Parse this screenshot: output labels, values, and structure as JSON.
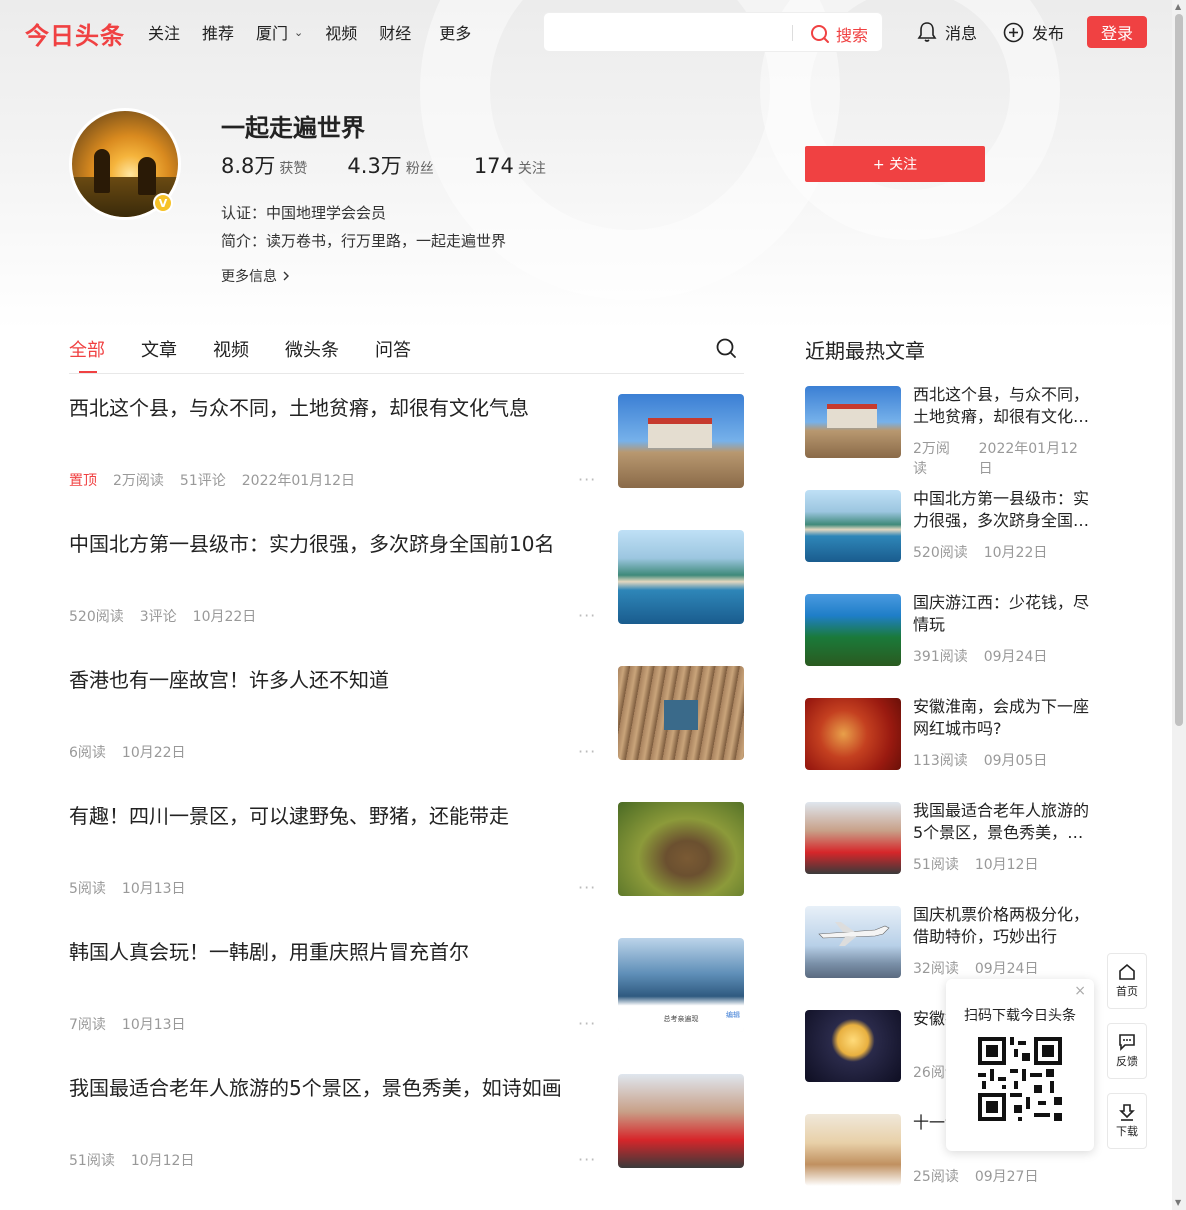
{
  "header": {
    "logo": "今日头条",
    "nav": [
      {
        "label": "关注"
      },
      {
        "label": "推荐"
      },
      {
        "label": "厦门",
        "dropdown": true
      },
      {
        "label": "视频"
      },
      {
        "label": "财经"
      },
      {
        "label": "更多"
      }
    ],
    "search": {
      "placeholder": "",
      "button": "搜索"
    },
    "messages": "消息",
    "publish": "发布",
    "login": "登录"
  },
  "profile": {
    "name": "一起走遍世界",
    "stats": [
      {
        "num": "8.8万",
        "label": "获赞"
      },
      {
        "num": "4.3万",
        "label": "粉丝"
      },
      {
        "num": "174",
        "label": "关注"
      }
    ],
    "certification": "认证：中国地理学会会员",
    "bio": "简介：读万卷书，行万里路，一起走遍世界",
    "more_info": "更多信息",
    "follow_button": "+ 关注",
    "verified_badge": "V"
  },
  "tabs": [
    "全部",
    "文章",
    "视频",
    "微头条",
    "问答"
  ],
  "feed": [
    {
      "title": "西北这个县，与众不同，土地贫瘠，却很有文化气息",
      "pinned": "置顶",
      "meta": [
        "2万阅读",
        "51评论",
        "2022年01月12日"
      ],
      "thumb": "th-1"
    },
    {
      "title": "中国北方第一县级市：实力很强，多次跻身全国前10名",
      "meta": [
        "520阅读",
        "3评论",
        "10月22日"
      ],
      "thumb": "th-2"
    },
    {
      "title": "香港也有一座故宫！许多人还不知道",
      "meta": [
        "6阅读",
        "10月22日"
      ],
      "thumb": "th-3"
    },
    {
      "title": "有趣！四川一景区，可以逮野兔、野猪，还能带走",
      "meta": [
        "5阅读",
        "10月13日"
      ],
      "thumb": "th-4"
    },
    {
      "title": "韩国人真会玩！一韩剧，用重庆照片冒充首尔",
      "meta": [
        "7阅读",
        "10月13日"
      ],
      "thumb": "th-5",
      "thumb_caption": "总考亲遍现",
      "thumb_caption2": "编辑"
    },
    {
      "title": "我国最适合老年人旅游的5个景区，景色秀美，如诗如画",
      "meta": [
        "51阅读",
        "10月12日"
      ],
      "thumb": "th-6"
    }
  ],
  "sidebar": {
    "title": "近期最热文章",
    "items": [
      {
        "title": "西北这个县，与众不同，土地贫瘠，却很有文化气息",
        "reads": "2万阅读",
        "date": "2022年01月12日",
        "thumb": "th-1"
      },
      {
        "title": "中国北方第一县级市：实力很强，多次跻身全国前10名",
        "reads": "520阅读",
        "date": "10月22日",
        "thumb": "th-2"
      },
      {
        "title": "国庆游江西：少花钱，尽情玩",
        "reads": "391阅读",
        "date": "09月24日",
        "thumb": "th-7"
      },
      {
        "title": "安徽淮南，会成为下一座网红城市吗?",
        "reads": "113阅读",
        "date": "09月05日",
        "thumb": "th-8"
      },
      {
        "title": "我国最适合老年人旅游的5个景区，景色秀美，如诗如画",
        "reads": "51阅读",
        "date": "10月12日",
        "thumb": "th-6"
      },
      {
        "title": "国庆机票价格两极分化，借助特价，巧妙出行",
        "reads": "32阅读",
        "date": "09月24日",
        "thumb": "th-9"
      },
      {
        "title": "安徽打卡",
        "reads": "26阅读",
        "date": "",
        "thumb": "th-10"
      },
      {
        "title": "十一该怎么过",
        "reads": "25阅读",
        "date": "09月27日",
        "thumb": "th-11"
      }
    ]
  },
  "qr_popup": {
    "title": "扫码下载今日头条"
  },
  "float_buttons": [
    {
      "label": "首页",
      "icon": "home-icon"
    },
    {
      "label": "反馈",
      "icon": "feedback-icon"
    },
    {
      "label": "下载",
      "icon": "download-icon"
    }
  ],
  "colors": {
    "brand": "#f04142"
  }
}
